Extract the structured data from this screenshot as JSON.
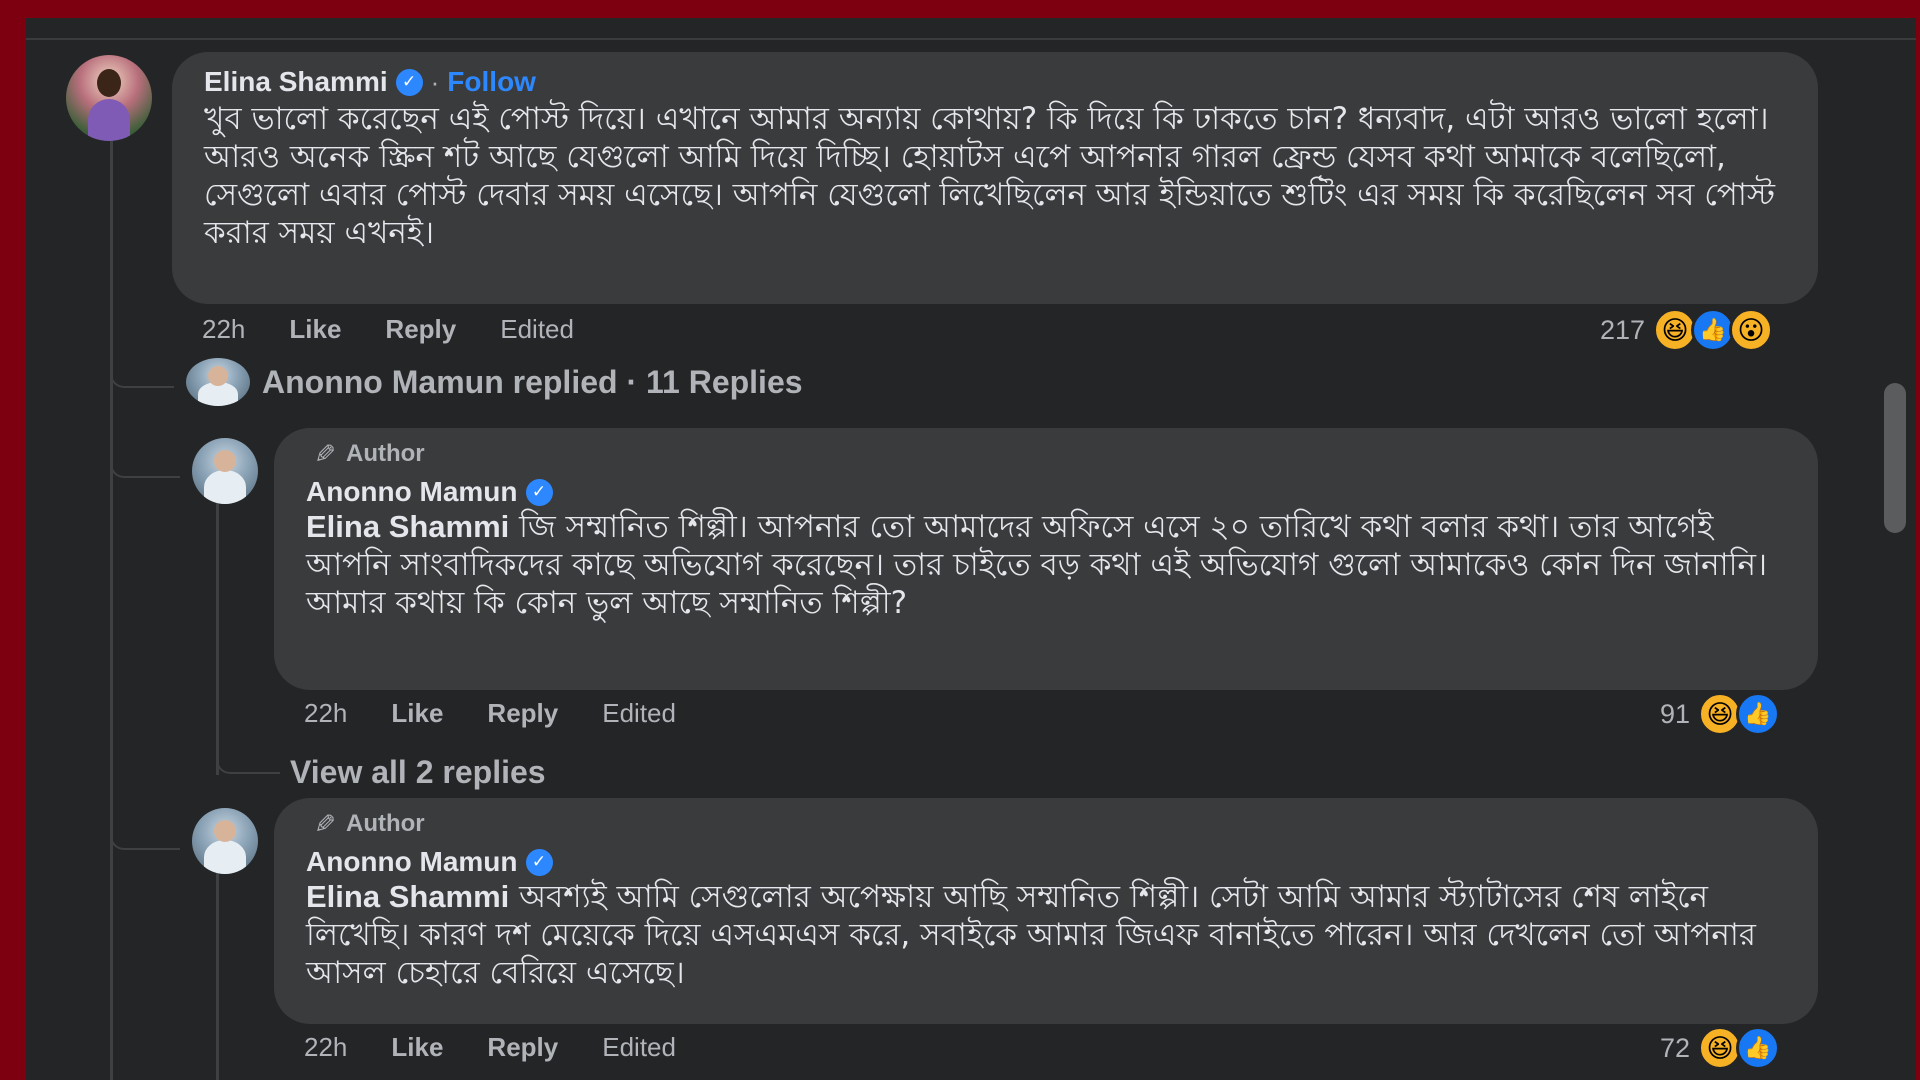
{
  "thread": {
    "top_comment": {
      "author": "Elina Shammi",
      "follow_separator": "·",
      "follow_label": "Follow",
      "text": "খুব ভালো করেছেন এই পোস্ট দিয়ে। এখানে আমার অন্যায় কোথায়? কি দিয়ে কি ঢাকতে চান? ধন্যবাদ, এটা আরও ভালো হলো।আরও অনেক স্ক্রিন শট আছে যেগুলো আমি দিয়ে দিচ্ছি। হোয়াটস এপে আপনার গারল ফ্রেন্ড যেসব কথা আমাকে বলেছিলো, সেগুলো এবার পোস্ট দেবার সময় এসেছে। আপনি যেগুলো লিখেছিলেন আর ইন্ডিয়াতে শুটিং এর সময় কি করেছিলেন সব পোস্ট করার সময় এখনই।",
      "time": "22h",
      "like_label": "Like",
      "reply_label": "Reply",
      "edited_label": "Edited",
      "reaction_count": "217",
      "reactions": [
        "haha",
        "like",
        "wow"
      ]
    },
    "replied_summary": "Anonno Mamun replied · 11 Replies",
    "replies": [
      {
        "author_badge": "Author",
        "author": "Anonno Mamun",
        "mention": "Elina Shammi",
        "text": " জি সম্মানিত শিল্পী। আপনার তো আমাদের অফিসে এসে ২০ তারিখে কথা বলার কথা। তার আগেই আপনি সাংবাদিকদের কাছে অভিযোগ করেছেন। তার চাইতে বড় কথা এই অভিযোগ গুলো আমাকেও কোন দিন জানানি। আমার কথায় কি কোন ভুল আছে সম্মানিত শিল্পী?",
        "time": "22h",
        "like_label": "Like",
        "reply_label": "Reply",
        "edited_label": "Edited",
        "reaction_count": "91",
        "reactions": [
          "haha",
          "like"
        ]
      },
      {
        "author_badge": "Author",
        "author": "Anonno Mamun",
        "mention": "Elina Shammi",
        "text": " অবশ্যই আমি সেগুলোর অপেক্ষায় আছি সম্মানিত শিল্পী। সেটা আমি আমার স্ট্যাটাসের শেষ লাইনে লিখেছি। কারণ দশ মেয়েকে দিয়ে এসএমএস করে, সবাইকে আমার জিএফ বানাইতে পারেন। আর দেখলেন তো আপনার আসল চেহারে বেরিয়ে এসেছে।",
        "time": "22h",
        "like_label": "Like",
        "reply_label": "Reply",
        "edited_label": "Edited",
        "reaction_count": "72",
        "reactions": [
          "haha",
          "like"
        ]
      }
    ],
    "view_all_replies": "View all 2 replies"
  },
  "colors": {
    "frame": "#7d0011",
    "panel": "#242526",
    "bubble": "#3a3b3c",
    "text": "#e4e6eb",
    "muted": "#b0b3b8",
    "accent": "#2d88ff"
  },
  "icons": {
    "verified": "verified-badge-icon",
    "author": "pencil-icon",
    "haha": "haha-reaction-icon",
    "like": "like-reaction-icon",
    "wow": "wow-reaction-icon"
  }
}
